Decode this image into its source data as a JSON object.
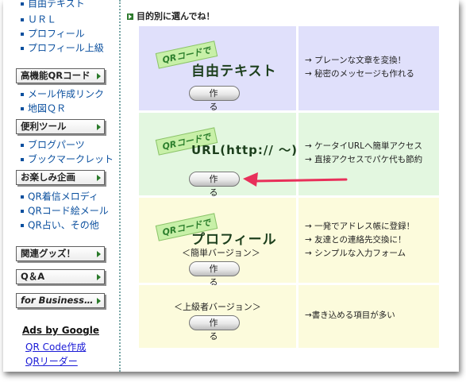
{
  "sidebar": {
    "top_links": [
      "自由テキスト",
      "ＵＲＬ",
      "プロフィール",
      "プロフィール上級"
    ],
    "categories": [
      {
        "label": "高機能QRコード",
        "links": [
          "メール作成リンク",
          "地図ＱＲ"
        ]
      },
      {
        "label": "便利ツール",
        "links": [
          "ブログパーツ",
          "ブックマークレット"
        ]
      },
      {
        "label": "お楽しみ企画",
        "links": [
          "QR着信メロディ",
          "QRコード絵メール",
          "QR占い、その他"
        ]
      },
      {
        "label": "関連グッズ！",
        "links": []
      },
      {
        "label": "Q＆A",
        "links": []
      },
      {
        "label": "for Business…",
        "links": []
      }
    ],
    "ads": {
      "title": "Ads by Google",
      "links": [
        "QR Code作成",
        "QRリーダー"
      ]
    }
  },
  "main": {
    "heading": "目的別に選んでね！",
    "stamp_text": "QRコードで",
    "make_button": "作　る",
    "rows": [
      {
        "title": "自由テキスト",
        "subtitle": "",
        "desc": [
          "→ プレーンな文章を変換！",
          "→ 秘密のメッセージも作れる"
        ]
      },
      {
        "title": "URL(http:// 〜)",
        "subtitle": "",
        "desc": [
          "→ ケータイURLへ簡単アクセス",
          "→ 直接アクセスでパケ代も節約"
        ]
      },
      {
        "title": "プロフィール",
        "subtitle": "＜簡単バージョン＞",
        "desc": [
          "→ 一発でアドレス帳に登録！",
          "→ 友達との連絡先交換に！",
          "→ シンプルな入力フォーム"
        ]
      },
      {
        "title": "",
        "subtitle": "＜上級者バージョン＞",
        "desc": [
          "→書き込める項目が多い"
        ]
      }
    ]
  },
  "colors": {
    "row_blue": "#e0e0fb",
    "row_green": "#e3f7e0",
    "row_yellow": "#fcfbdc",
    "link": "#0a4f9e",
    "arrow_annotation": "#e8305a"
  }
}
